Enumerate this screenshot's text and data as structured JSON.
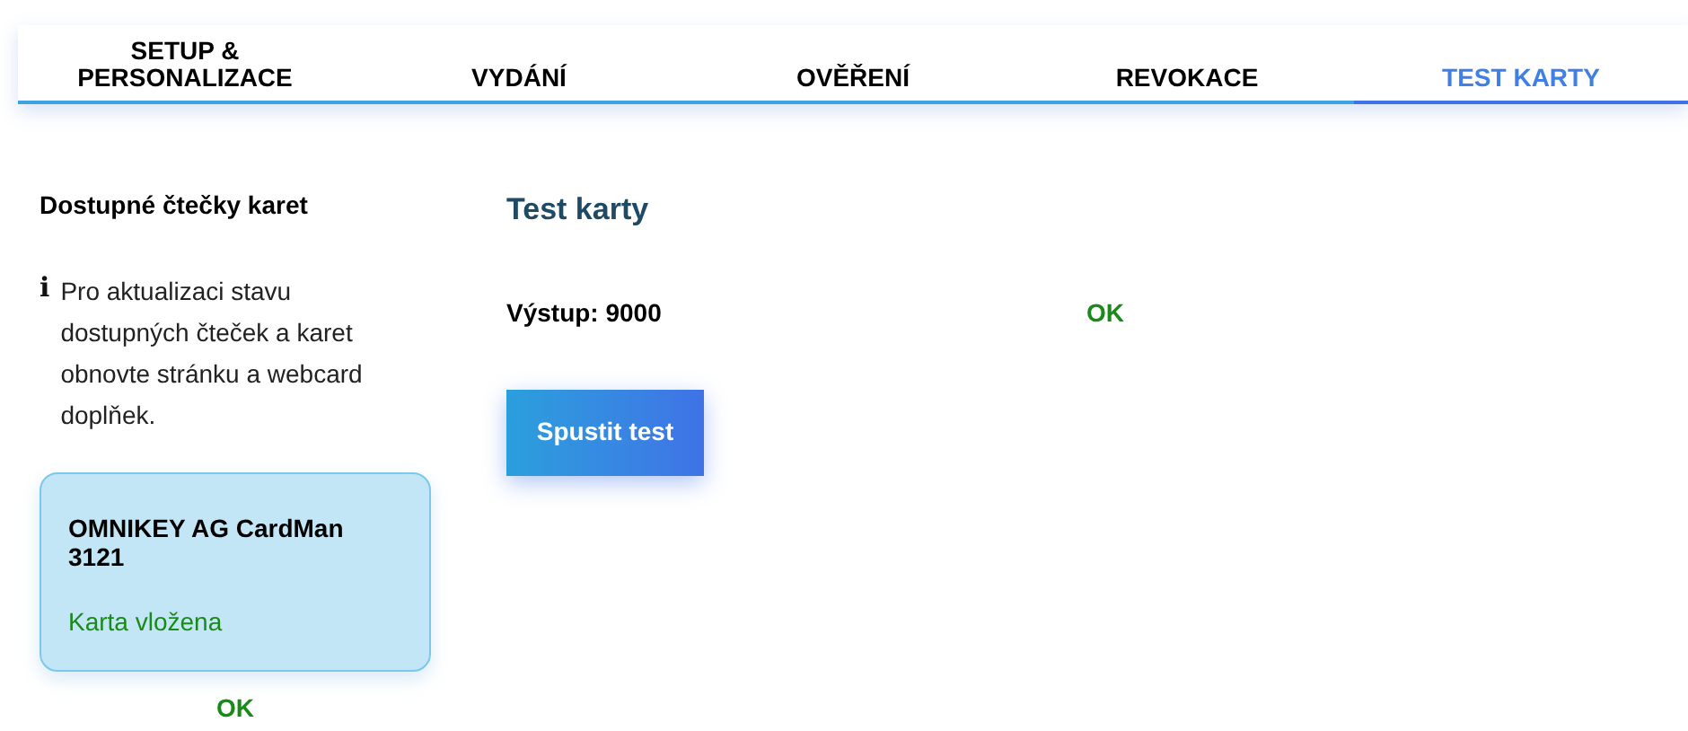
{
  "tabs": [
    {
      "label": "SETUP &\nPERSONALIZACE",
      "selected": false
    },
    {
      "label": "VYDÁNÍ",
      "selected": false
    },
    {
      "label": "OVĚŘENÍ",
      "selected": false
    },
    {
      "label": "REVOKACE",
      "selected": false
    },
    {
      "label": "TEST KARTY",
      "selected": true
    }
  ],
  "sidebar": {
    "title": "Dostupné čtečky karet",
    "info_icon": "i",
    "info": "Pro aktualizaci stavu dostupných čteček a karet obnovte stránku a webcard doplňek.",
    "readers": [
      {
        "name": "OMNIKEY AG CardMan 3121",
        "status": "Karta vložena"
      }
    ],
    "result": "OK"
  },
  "main": {
    "title": "Test karty",
    "output": "Výstup: 9000",
    "result": "OK",
    "button": "Spustit test"
  }
}
